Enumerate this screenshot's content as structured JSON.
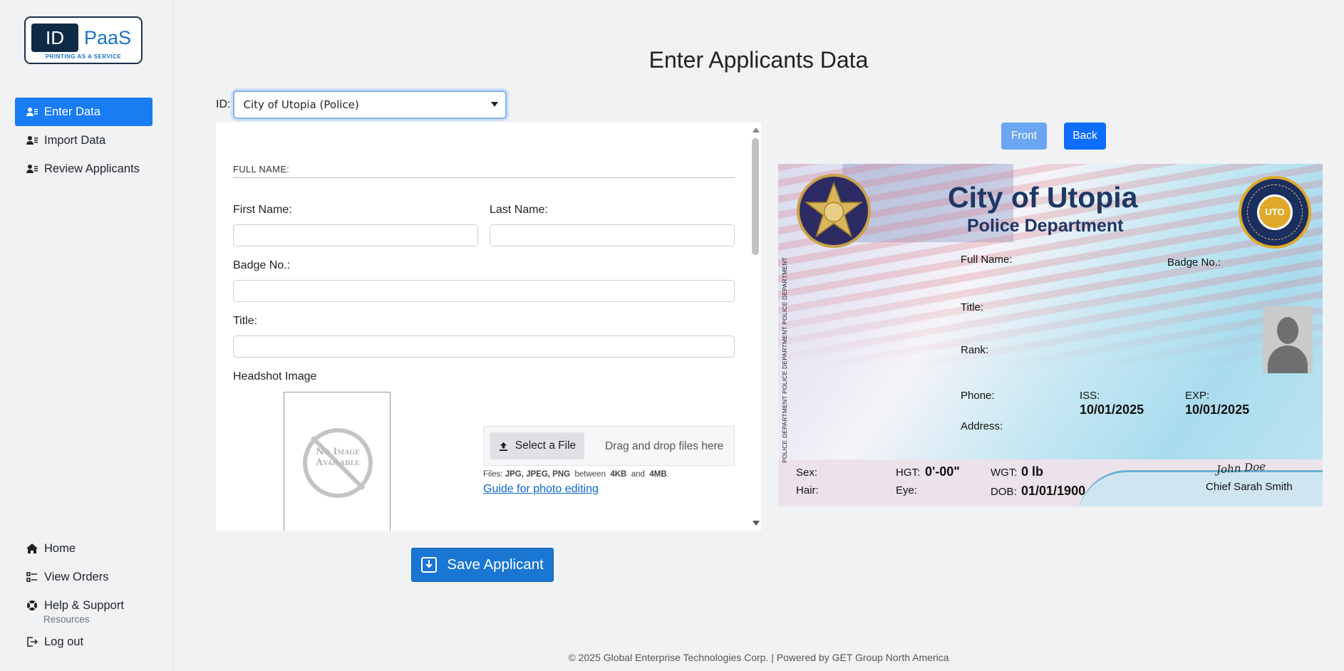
{
  "logo": {
    "id_text": "ID",
    "brand_text": "PaaS",
    "tagline": "PRINTING AS A SERVICE"
  },
  "nav_top": [
    {
      "label": "Enter Data",
      "icon": "user-list-icon",
      "active": true
    },
    {
      "label": "Import Data",
      "icon": "user-list-icon",
      "active": false
    },
    {
      "label": "Review Applicants",
      "icon": "user-list-icon",
      "active": false
    }
  ],
  "nav_bottom": {
    "home": "Home",
    "view_orders": "View Orders",
    "help": "Help & Support",
    "help_sub": "Resources",
    "logout": "Log out"
  },
  "page": {
    "title": "Enter Applicants Data"
  },
  "id_select": {
    "label": "ID:",
    "value": "City of Utopia (Police)"
  },
  "form": {
    "section": "FULL NAME:",
    "first_name_label": "First Name:",
    "last_name_label": "Last Name:",
    "badge_label": "Badge No.:",
    "title_label": "Title:",
    "headshot_label": "Headshot Image",
    "no_image_text": "No Image Available",
    "select_file": "Select a File",
    "drag_drop": "Drag and drop files here",
    "files_prefix": "Files:",
    "files_types": "JPG, JPEG, PNG",
    "files_between": "between",
    "files_min": "4KB",
    "files_and": "and",
    "files_max": "4MB",
    "guide_link": "Guide for photo editing",
    "save_button": "Save Applicant"
  },
  "preview": {
    "front_button": "Front",
    "back_button": "Back",
    "card": {
      "title": "City of Utopia",
      "subtitle": "Police Department",
      "full_name_label": "Full Name:",
      "badge_label": "Badge No.:",
      "title_label": "Title:",
      "rank_label": "Rank:",
      "phone_label": "Phone:",
      "address_label": "Address:",
      "iss_label": "ISS:",
      "iss_value": "10/01/2025",
      "exp_label": "EXP:",
      "exp_value": "10/01/2025",
      "sex_label": "Sex:",
      "hair_label": "Hair:",
      "hgt_label": "HGT:",
      "hgt_value": "0'-00\"",
      "eye_label": "Eye:",
      "wgt_label": "WGT:",
      "wgt_value": "0 lb",
      "dob_label": "DOB:",
      "dob_value": "01/01/1900",
      "signature": "John Doe",
      "chief": "Chief Sarah Smith",
      "seal_text": "UTO",
      "vertical_text": "POLICE DEPARTMENT POLICE DEPARTMENT POLICE DEPARTMENT POLICE D"
    }
  },
  "footer": "© 2025 Global Enterprise Technologies Corp. | Powered by GET Group North America",
  "colors": {
    "accent": "#1a7cf2",
    "save": "#1976d2",
    "card_title": "#1f3764"
  }
}
